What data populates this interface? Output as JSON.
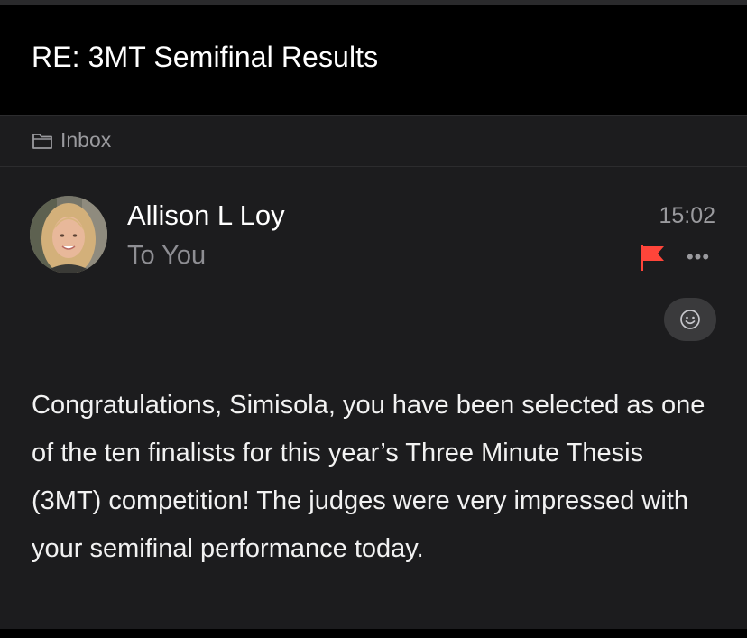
{
  "email": {
    "subject": "RE: 3MT Semifinal Results",
    "folder": {
      "icon": "folder-icon",
      "label": "Inbox"
    },
    "sender": {
      "name": "Allison L Loy",
      "avatar": "avatar-photo"
    },
    "recipient": "To You",
    "time": "15:02",
    "flag": {
      "icon": "flag-icon",
      "color": "#ff453a"
    },
    "more": {
      "icon": "more-icon",
      "label": "•••"
    },
    "reaction": {
      "icon": "smiley-icon"
    },
    "body": "Congratulations, Simisola, you have been selected as one of the ten finalists for this year’s Three Minute Thesis (3MT) competition! The judges were very impressed with your semifinal performance today."
  },
  "theme": {
    "background": "#000000",
    "panel": "#1c1c1e",
    "text_primary": "#ffffff",
    "text_secondary": "#8e8e93",
    "accent_flag": "#ff453a"
  }
}
